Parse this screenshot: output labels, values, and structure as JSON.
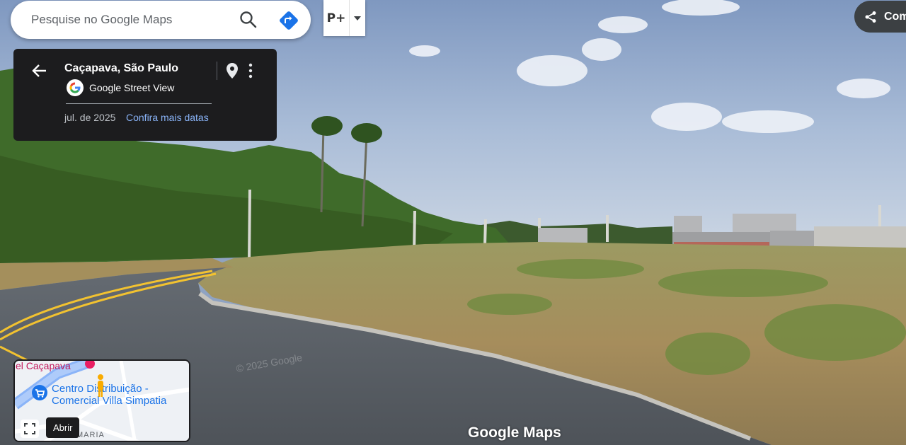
{
  "search": {
    "placeholder": "Pesquise no Google Maps",
    "value": ""
  },
  "layer_button": {
    "label": "P+"
  },
  "share": {
    "label": "Com"
  },
  "place_card": {
    "title": "Caçapava, São Paulo",
    "source": "Google Street View",
    "date": "jul. de 2025",
    "more_dates_link": "Confira mais datas"
  },
  "minimap": {
    "road_label": "el Caçapava",
    "poi_line1": "Centro Distribuição -",
    "poi_line2": "Comercial Villa Simpatia",
    "street_label": "MARIA",
    "tooltip": "Abrir"
  },
  "watermark": "Google Maps",
  "copyright": "© 2025 Google",
  "colors": {
    "card_bg": "#1c1c1e",
    "link": "#8ab4f8",
    "directions": "#1a73e8",
    "road_line": "#f2c230"
  }
}
